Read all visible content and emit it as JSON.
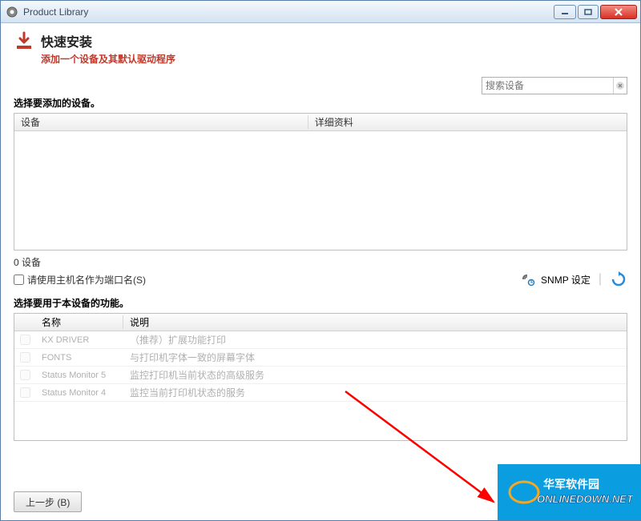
{
  "window": {
    "title": "Product Library"
  },
  "quickinstall": {
    "title": "快速安装",
    "subtitle": "添加一个设备及其默认驱动程序"
  },
  "device_section": {
    "label": "选择要添加的设备。",
    "search_placeholder": "搜索设备",
    "columns": {
      "name": "设备",
      "detail": "详细资料"
    },
    "count_text": "0 设备",
    "use_hostname": "请使用主机名作为端口名(S)",
    "snmp_label": "SNMP 设定"
  },
  "function_section": {
    "label": "选择要用于本设备的功能。",
    "columns": {
      "name": "名称",
      "desc": "说明"
    },
    "rows": [
      {
        "name": "KX DRIVER",
        "desc": "（推荐）扩展功能打印"
      },
      {
        "name": "FONTS",
        "desc": "与打印机字体一致的屏幕字体"
      },
      {
        "name": "Status Monitor 5",
        "desc": "监控打印机当前状态的高级服务"
      },
      {
        "name": "Status Monitor 4",
        "desc": "监控当前打印机状态的服务"
      }
    ]
  },
  "buttons": {
    "back": "上一步 (B)"
  },
  "watermark": {
    "cn": "华军软件园",
    "en": "ONLINEDOWN.NET"
  }
}
